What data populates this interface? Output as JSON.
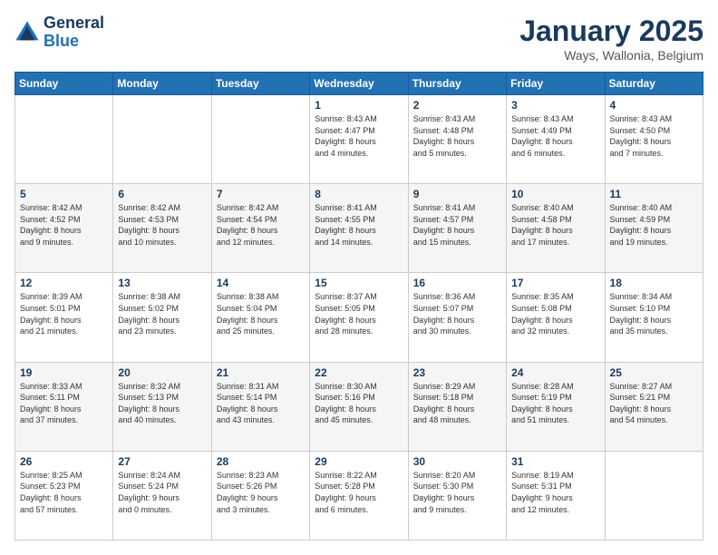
{
  "header": {
    "logo_line1": "General",
    "logo_line2": "Blue",
    "month": "January 2025",
    "location": "Ways, Wallonia, Belgium"
  },
  "weekdays": [
    "Sunday",
    "Monday",
    "Tuesday",
    "Wednesday",
    "Thursday",
    "Friday",
    "Saturday"
  ],
  "weeks": [
    [
      {
        "day": "",
        "info": ""
      },
      {
        "day": "",
        "info": ""
      },
      {
        "day": "",
        "info": ""
      },
      {
        "day": "1",
        "info": "Sunrise: 8:43 AM\nSunset: 4:47 PM\nDaylight: 8 hours\nand 4 minutes."
      },
      {
        "day": "2",
        "info": "Sunrise: 8:43 AM\nSunset: 4:48 PM\nDaylight: 8 hours\nand 5 minutes."
      },
      {
        "day": "3",
        "info": "Sunrise: 8:43 AM\nSunset: 4:49 PM\nDaylight: 8 hours\nand 6 minutes."
      },
      {
        "day": "4",
        "info": "Sunrise: 8:43 AM\nSunset: 4:50 PM\nDaylight: 8 hours\nand 7 minutes."
      }
    ],
    [
      {
        "day": "5",
        "info": "Sunrise: 8:42 AM\nSunset: 4:52 PM\nDaylight: 8 hours\nand 9 minutes."
      },
      {
        "day": "6",
        "info": "Sunrise: 8:42 AM\nSunset: 4:53 PM\nDaylight: 8 hours\nand 10 minutes."
      },
      {
        "day": "7",
        "info": "Sunrise: 8:42 AM\nSunset: 4:54 PM\nDaylight: 8 hours\nand 12 minutes."
      },
      {
        "day": "8",
        "info": "Sunrise: 8:41 AM\nSunset: 4:55 PM\nDaylight: 8 hours\nand 14 minutes."
      },
      {
        "day": "9",
        "info": "Sunrise: 8:41 AM\nSunset: 4:57 PM\nDaylight: 8 hours\nand 15 minutes."
      },
      {
        "day": "10",
        "info": "Sunrise: 8:40 AM\nSunset: 4:58 PM\nDaylight: 8 hours\nand 17 minutes."
      },
      {
        "day": "11",
        "info": "Sunrise: 8:40 AM\nSunset: 4:59 PM\nDaylight: 8 hours\nand 19 minutes."
      }
    ],
    [
      {
        "day": "12",
        "info": "Sunrise: 8:39 AM\nSunset: 5:01 PM\nDaylight: 8 hours\nand 21 minutes."
      },
      {
        "day": "13",
        "info": "Sunrise: 8:38 AM\nSunset: 5:02 PM\nDaylight: 8 hours\nand 23 minutes."
      },
      {
        "day": "14",
        "info": "Sunrise: 8:38 AM\nSunset: 5:04 PM\nDaylight: 8 hours\nand 25 minutes."
      },
      {
        "day": "15",
        "info": "Sunrise: 8:37 AM\nSunset: 5:05 PM\nDaylight: 8 hours\nand 28 minutes."
      },
      {
        "day": "16",
        "info": "Sunrise: 8:36 AM\nSunset: 5:07 PM\nDaylight: 8 hours\nand 30 minutes."
      },
      {
        "day": "17",
        "info": "Sunrise: 8:35 AM\nSunset: 5:08 PM\nDaylight: 8 hours\nand 32 minutes."
      },
      {
        "day": "18",
        "info": "Sunrise: 8:34 AM\nSunset: 5:10 PM\nDaylight: 8 hours\nand 35 minutes."
      }
    ],
    [
      {
        "day": "19",
        "info": "Sunrise: 8:33 AM\nSunset: 5:11 PM\nDaylight: 8 hours\nand 37 minutes."
      },
      {
        "day": "20",
        "info": "Sunrise: 8:32 AM\nSunset: 5:13 PM\nDaylight: 8 hours\nand 40 minutes."
      },
      {
        "day": "21",
        "info": "Sunrise: 8:31 AM\nSunset: 5:14 PM\nDaylight: 8 hours\nand 43 minutes."
      },
      {
        "day": "22",
        "info": "Sunrise: 8:30 AM\nSunset: 5:16 PM\nDaylight: 8 hours\nand 45 minutes."
      },
      {
        "day": "23",
        "info": "Sunrise: 8:29 AM\nSunset: 5:18 PM\nDaylight: 8 hours\nand 48 minutes."
      },
      {
        "day": "24",
        "info": "Sunrise: 8:28 AM\nSunset: 5:19 PM\nDaylight: 8 hours\nand 51 minutes."
      },
      {
        "day": "25",
        "info": "Sunrise: 8:27 AM\nSunset: 5:21 PM\nDaylight: 8 hours\nand 54 minutes."
      }
    ],
    [
      {
        "day": "26",
        "info": "Sunrise: 8:25 AM\nSunset: 5:23 PM\nDaylight: 8 hours\nand 57 minutes."
      },
      {
        "day": "27",
        "info": "Sunrise: 8:24 AM\nSunset: 5:24 PM\nDaylight: 9 hours\nand 0 minutes."
      },
      {
        "day": "28",
        "info": "Sunrise: 8:23 AM\nSunset: 5:26 PM\nDaylight: 9 hours\nand 3 minutes."
      },
      {
        "day": "29",
        "info": "Sunrise: 8:22 AM\nSunset: 5:28 PM\nDaylight: 9 hours\nand 6 minutes."
      },
      {
        "day": "30",
        "info": "Sunrise: 8:20 AM\nSunset: 5:30 PM\nDaylight: 9 hours\nand 9 minutes."
      },
      {
        "day": "31",
        "info": "Sunrise: 8:19 AM\nSunset: 5:31 PM\nDaylight: 9 hours\nand 12 minutes."
      },
      {
        "day": "",
        "info": ""
      }
    ]
  ]
}
